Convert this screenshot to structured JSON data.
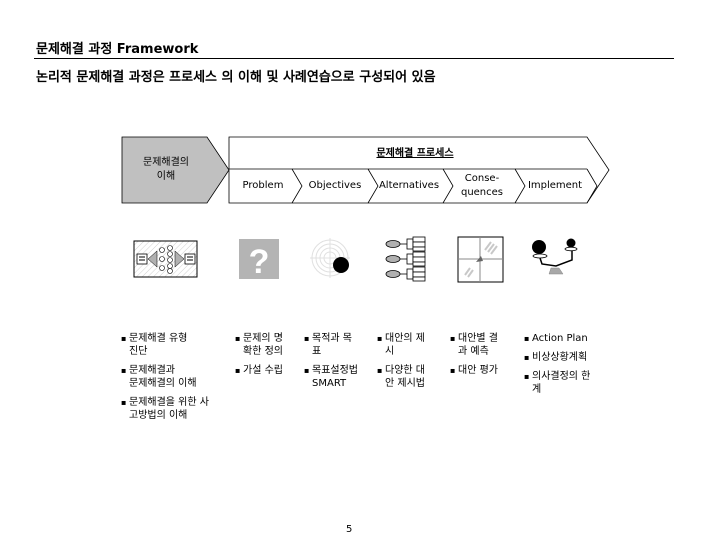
{
  "header": {
    "title": "문제해결 과정 Framework",
    "subtitle": "논리적 문제해결 과정은 프로세스 의 이해 및  사례연습으로 구성되어 있음"
  },
  "diagram": {
    "left_stage": {
      "label_line1": "문제해결의",
      "label_line2": "이해",
      "fill": "#c0c0c0"
    },
    "process": {
      "title": "문제해결 프로세스",
      "steps": [
        {
          "label": "Problem"
        },
        {
          "label": "Objectives"
        },
        {
          "label": "Alternatives"
        },
        {
          "label_line1": "Conse-",
          "label_line2": "quences"
        },
        {
          "label": "Implement"
        }
      ]
    },
    "icons": [
      "process-flow-icon",
      "question-mark-icon",
      "target-icon",
      "decision-tree-icon",
      "matrix-icon",
      "balance-scale-icon"
    ],
    "question_glyph": "?"
  },
  "columns": [
    {
      "bullets": [
        {
          "line1": "문제해결 유형",
          "line2": "진단"
        },
        {
          "line1": "문제해결과",
          "line2": "문제해결의 이해"
        },
        {
          "line1": "문제해결을 위한 사",
          "line2": "고방법의 이해"
        }
      ]
    },
    {
      "bullets": [
        {
          "line1": "문제의 명",
          "line2": "확한 정의"
        },
        {
          "line1": "가설 수립",
          "line2": ""
        }
      ]
    },
    {
      "bullets": [
        {
          "line1": "목적과 목",
          "line2": "표"
        },
        {
          "line1": "목표설정법",
          "line2": "SMART"
        }
      ]
    },
    {
      "bullets": [
        {
          "line1": "대안의 제",
          "line2": "시"
        },
        {
          "line1": "다양한 대",
          "line2": "안 제시법"
        }
      ]
    },
    {
      "bullets": [
        {
          "line1": "대안별 결",
          "line2": "과 예측"
        },
        {
          "line1": "대안 평가",
          "line2": ""
        }
      ]
    },
    {
      "bullets": [
        {
          "line1": "Action Plan",
          "line2": ""
        },
        {
          "line1": "비상상황계획",
          "line2": ""
        },
        {
          "line1": "의사결정의 한",
          "line2": "계"
        }
      ]
    }
  ],
  "footer": {
    "page_number": "5"
  }
}
